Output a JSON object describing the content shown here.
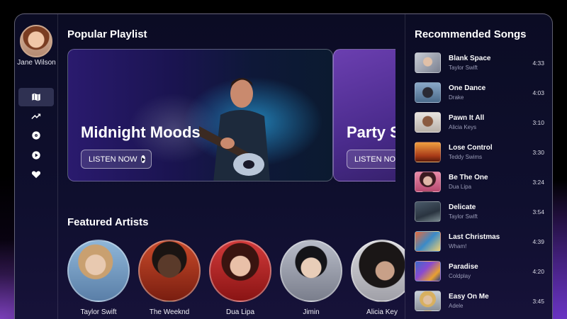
{
  "user": {
    "name": "Jane Wilson"
  },
  "sidebar": {
    "nav": [
      {
        "icon": "map-icon",
        "active": true
      },
      {
        "icon": "trending-icon",
        "active": false
      },
      {
        "icon": "disc-icon",
        "active": false
      },
      {
        "icon": "play-icon",
        "active": false
      },
      {
        "icon": "heart-icon",
        "active": false
      }
    ]
  },
  "popular": {
    "title": "Popular Playlist",
    "playlists": [
      {
        "title": "Midnight Moods",
        "button": "LISTEN NOW"
      },
      {
        "title": "Party S",
        "button": "LISTEN NOW"
      }
    ]
  },
  "featured": {
    "title": "Featured Artists",
    "artists": [
      {
        "name": "Taylor Swift"
      },
      {
        "name": "The Weeknd"
      },
      {
        "name": "Dua Lipa"
      },
      {
        "name": "Jimin"
      },
      {
        "name": "Alicia Key"
      }
    ]
  },
  "recommended": {
    "title": "Recommended Songs",
    "songs": [
      {
        "title": "Blank Space",
        "artist": "Taylor Swift",
        "duration": "4:33"
      },
      {
        "title": "One Dance",
        "artist": "Drake",
        "duration": "4:03"
      },
      {
        "title": "Pawn It All",
        "artist": "Alicia Keys",
        "duration": "3:10"
      },
      {
        "title": "Lose Control",
        "artist": "Teddy Swims",
        "duration": "3:30"
      },
      {
        "title": "Be The One",
        "artist": "Dua Lipa",
        "duration": "3:24"
      },
      {
        "title": "Delicate",
        "artist": "Taylor Swift",
        "duration": "3:54"
      },
      {
        "title": "Last Christmas",
        "artist": "Wham!",
        "duration": "4:39"
      },
      {
        "title": "Paradise",
        "artist": "Coldplay",
        "duration": "4:20"
      },
      {
        "title": "Easy On Me",
        "artist": "Adele",
        "duration": "3:45"
      }
    ]
  },
  "colors": {
    "accent": "#6a34c4",
    "panel": "#0f0f2e",
    "nav_active": "#2f3152"
  }
}
